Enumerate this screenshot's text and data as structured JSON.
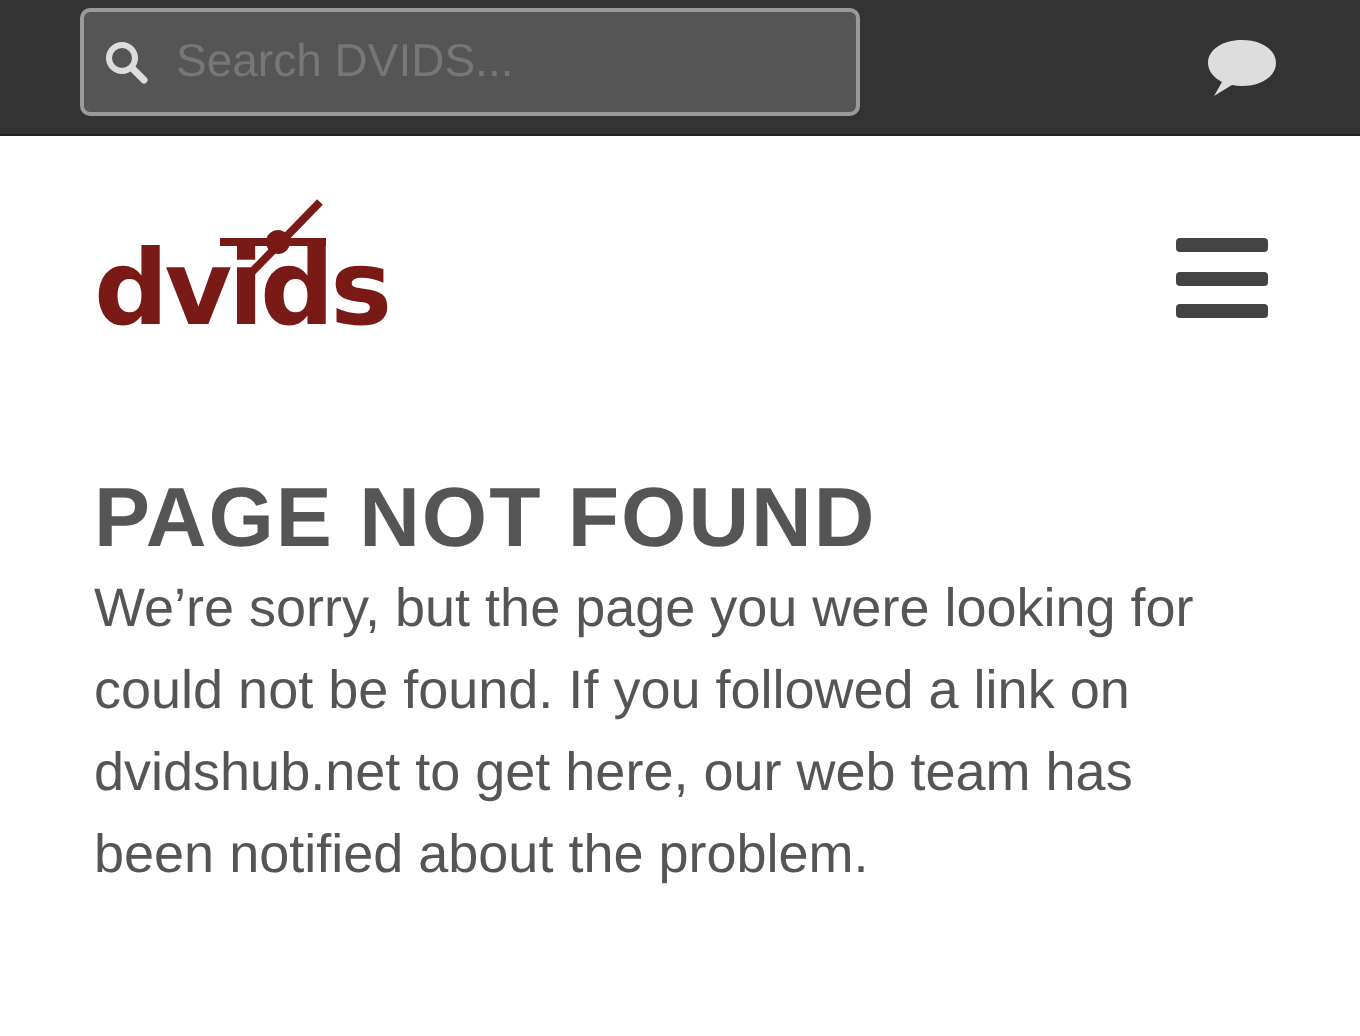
{
  "top_bar": {
    "search": {
      "placeholder": "Search DVIDS..."
    }
  },
  "header": {
    "logo": "dvids"
  },
  "content": {
    "title": "PAGE NOT FOUND",
    "message": "We’re sorry, but the page you were looking for could not be found. If you followed a link on dvidshub.net to get here, our web team has been notified about the problem."
  }
}
